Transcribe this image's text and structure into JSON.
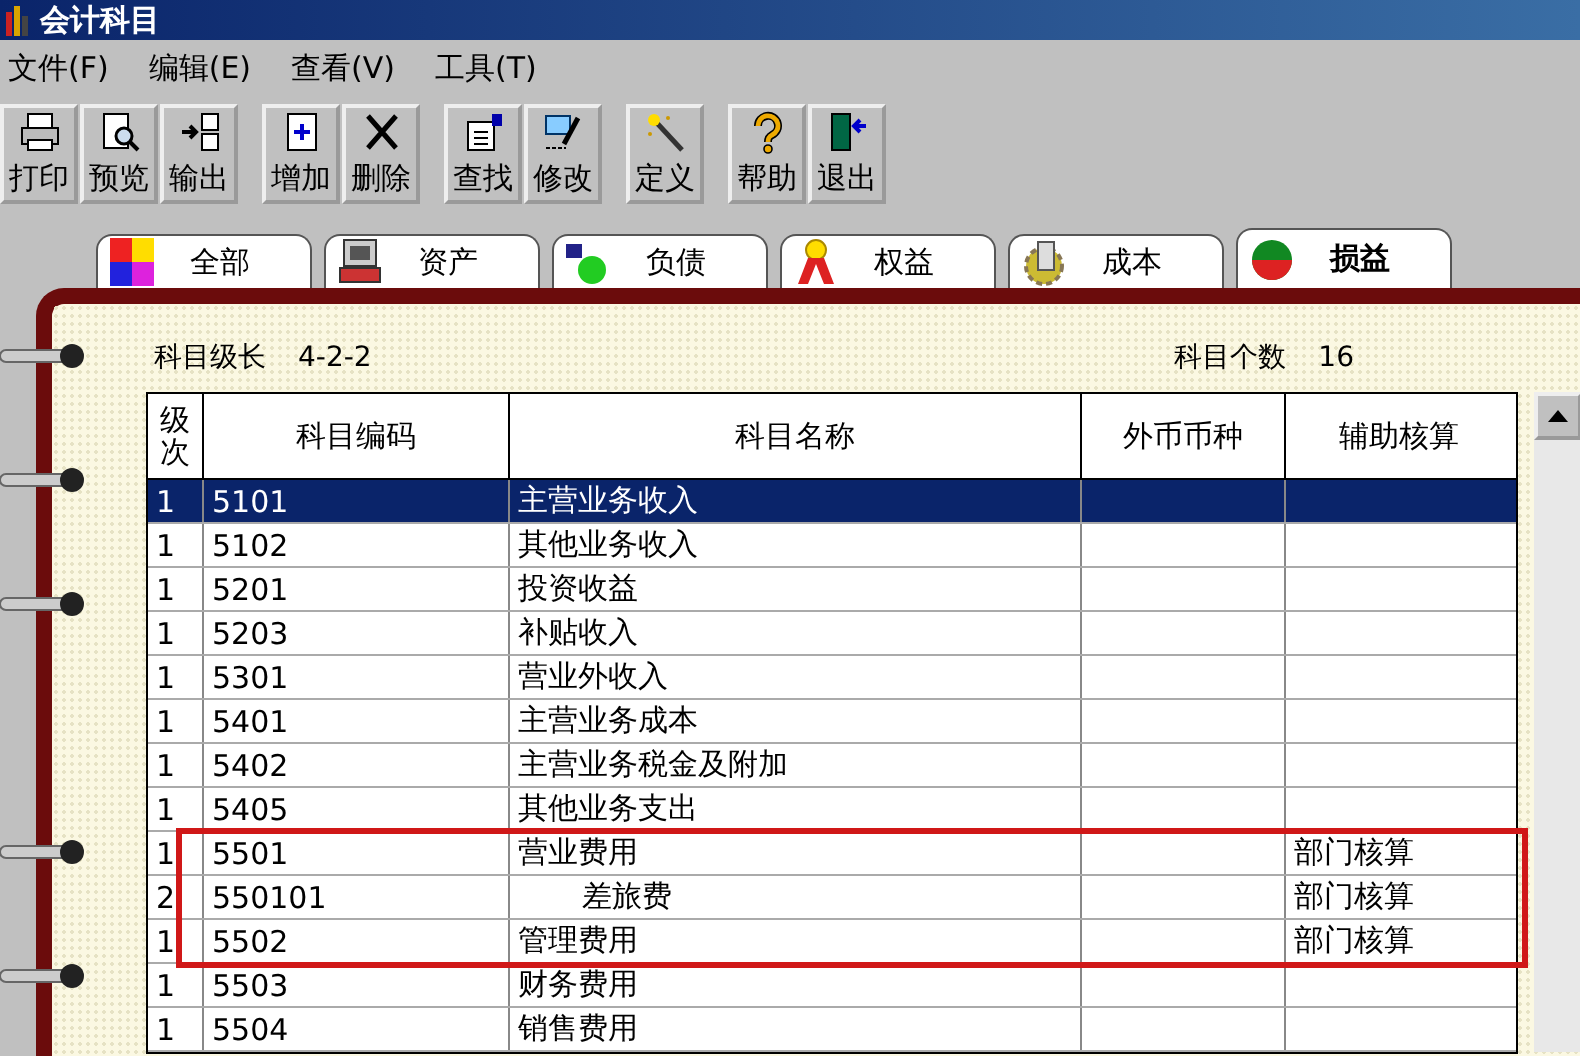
{
  "window": {
    "title": "会计科目"
  },
  "menu": [
    "文件(F)",
    "编辑(E)",
    "查看(V)",
    "工具(T)"
  ],
  "toolbar": [
    {
      "buttons": [
        {
          "label": "打印",
          "kind": "print"
        },
        {
          "label": "预览",
          "kind": "preview"
        },
        {
          "label": "输出",
          "kind": "export"
        }
      ]
    },
    {
      "buttons": [
        {
          "label": "增加",
          "kind": "add"
        },
        {
          "label": "删除",
          "kind": "delete"
        }
      ]
    },
    {
      "buttons": [
        {
          "label": "查找",
          "kind": "find"
        },
        {
          "label": "修改",
          "kind": "edit"
        }
      ]
    },
    {
      "buttons": [
        {
          "label": "定义",
          "kind": "define"
        }
      ]
    },
    {
      "buttons": [
        {
          "label": "帮助",
          "kind": "help"
        },
        {
          "label": "退出",
          "kind": "exit"
        }
      ]
    }
  ],
  "tabs": [
    {
      "label": "全部",
      "kind": "all",
      "selected": false
    },
    {
      "label": "资产",
      "kind": "asset",
      "selected": false
    },
    {
      "label": "负债",
      "kind": "liability",
      "selected": false
    },
    {
      "label": "权益",
      "kind": "equity",
      "selected": false
    },
    {
      "label": "成本",
      "kind": "cost",
      "selected": false
    },
    {
      "label": "损益",
      "kind": "profit",
      "selected": true
    }
  ],
  "info": {
    "level_label": "科目级长",
    "level_value": "4-2-2",
    "count_label": "科目个数",
    "count_value": "16"
  },
  "table": {
    "columns": [
      "级次",
      "科目编码",
      "科目名称",
      "外币币种",
      "辅助核算"
    ],
    "rows": [
      {
        "level": "1",
        "code": "5101",
        "name": "主营业务收入",
        "selected": true,
        "highlighted": false
      },
      {
        "level": "1",
        "code": "5102",
        "name": "其他业务收入",
        "selected": false,
        "highlighted": false
      },
      {
        "level": "1",
        "code": "5201",
        "name": "投资收益",
        "selected": false,
        "highlighted": false
      },
      {
        "level": "1",
        "code": "5203",
        "name": "补贴收入",
        "selected": false,
        "highlighted": false
      },
      {
        "level": "1",
        "code": "5301",
        "name": "营业外收入",
        "selected": false,
        "highlighted": false
      },
      {
        "level": "1",
        "code": "5401",
        "name": "主营业务成本",
        "selected": false,
        "highlighted": false
      },
      {
        "level": "1",
        "code": "5402",
        "name": "主营业务税金及附加",
        "selected": false,
        "highlighted": false
      },
      {
        "level": "1",
        "code": "5405",
        "name": "其他业务支出",
        "selected": false,
        "highlighted": false
      },
      {
        "level": "1",
        "code": "5501",
        "name": "营业费用",
        "auxiliary": "部门核算",
        "selected": false,
        "highlighted": true,
        "children": [
          {
            "level": "2",
            "code": "550101",
            "name": "差旅费",
            "auxiliary": "部门核算",
            "selected": false,
            "highlighted": true
          }
        ]
      },
      {
        "level": "1",
        "code": "5502",
        "name": "管理费用",
        "auxiliary": "部门核算",
        "selected": false,
        "highlighted": true
      },
      {
        "level": "1",
        "code": "5503",
        "name": "财务费用",
        "selected": false,
        "highlighted": false
      },
      {
        "level": "1",
        "code": "5504",
        "name": "销售费用",
        "selected": false,
        "highlighted": false
      }
    ]
  }
}
